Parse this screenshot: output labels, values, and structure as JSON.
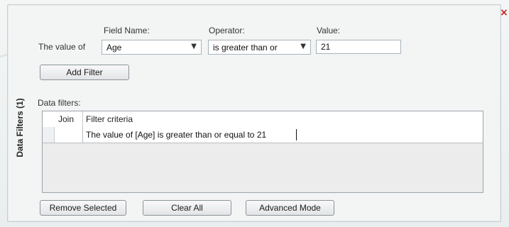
{
  "close_glyph": "×",
  "vertical_tab": {
    "label": "Data Filters (1)"
  },
  "filter_builder": {
    "prefix": "The value of",
    "field_name_label": "Field Name:",
    "field_name_value": "Age",
    "operator_label": "Operator:",
    "operator_value": "is greater than or",
    "value_label": "Value:",
    "value": "21",
    "add_filter_label": "Add Filter"
  },
  "data_filters": {
    "label": "Data filters:",
    "columns": [
      "Join",
      "Filter criteria"
    ],
    "rows": [
      {
        "join": "",
        "criteria": "The value of [Age] is greater than or equal to 21"
      }
    ]
  },
  "actions": {
    "remove_selected": "Remove Selected",
    "clear_all": "Clear All",
    "advanced_mode": "Advanced Mode"
  },
  "colors": {
    "close": "#c81f1f",
    "panel": "#f3f4f4",
    "border": "#9aa6ad"
  }
}
